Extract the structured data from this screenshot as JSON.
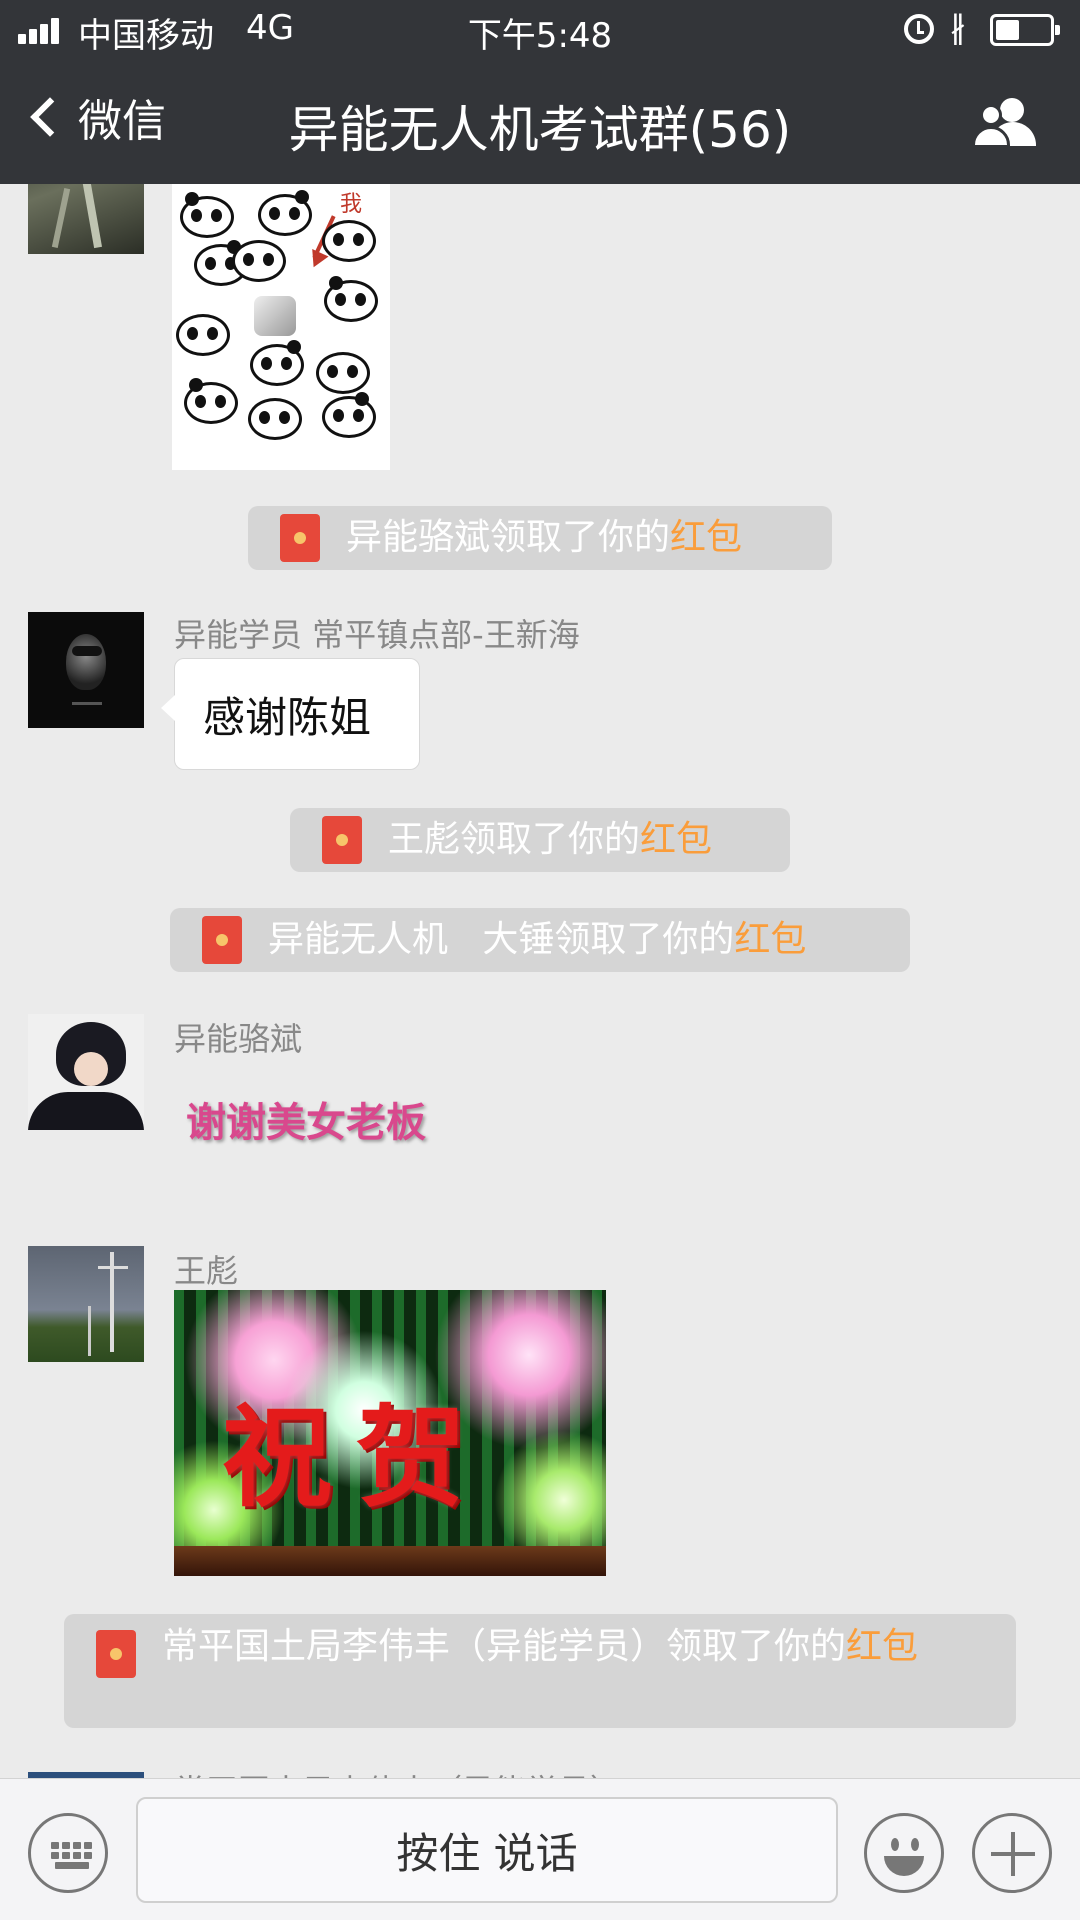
{
  "status_bar": {
    "carrier": "中国移动",
    "network": "4G",
    "time": "下午5:48",
    "bluetooth_symbol": "∦",
    "battery_level": 0.45
  },
  "nav": {
    "back_label": "微信",
    "title": "异能无人机考试群(56)",
    "members_icon": "group-members-icon"
  },
  "messages": {
    "sticker_text": "我",
    "sys1": {
      "text": "异能骆斌领取了你的",
      "highlight": "红包"
    },
    "msg1": {
      "sender": "异能学员 常平镇点部-王新海",
      "text": "感谢陈姐"
    },
    "sys2": {
      "text": "王彪领取了你的",
      "highlight": "红包"
    },
    "sys3": {
      "text": "异能无人机   大锤领取了你的",
      "highlight": "红包"
    },
    "msg2": {
      "sender": "异能骆斌",
      "text": "谢谢美女老板"
    },
    "msg3": {
      "sender": "王彪",
      "image_text": "祝贺"
    },
    "sys4": {
      "text": "常平国土局李伟丰（异能学员）领取了你的",
      "highlight": "红包"
    },
    "msg4_partial_sender": "常平国土局李伟丰（异能学员）"
  },
  "input_bar": {
    "hold_to_talk": "按住 说话",
    "left_icon": "keyboard-icon",
    "emoji_icon": "emoji-icon",
    "plus_icon": "plus-icon"
  },
  "colors": {
    "nav_bg": "#333539",
    "chat_bg": "#ebebeb",
    "red_packet_highlight": "#fa9d3b",
    "red_packet_icon": "#e6483a",
    "pink_text": "#d9488d"
  }
}
